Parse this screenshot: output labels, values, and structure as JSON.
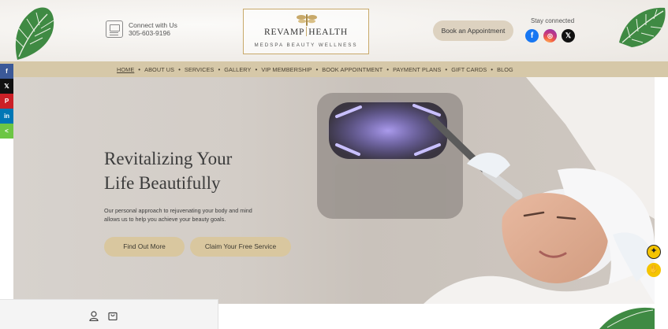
{
  "header": {
    "contact_label": "Connect with Us",
    "phone": "305-603-9196",
    "logo": {
      "name_left": "REVAMP",
      "name_right": "HEALTH",
      "tagline": "MEDSPA BEAUTY WELLNESS"
    },
    "book_button": "Book an Appointment",
    "stay_connected": "Stay connected",
    "social": [
      {
        "name": "facebook-icon",
        "glyph": "f"
      },
      {
        "name": "instagram-icon",
        "glyph": "◎"
      },
      {
        "name": "x-icon",
        "glyph": "𝕏"
      }
    ]
  },
  "nav": {
    "items": [
      "HOME",
      "ABOUT US",
      "SERVICES",
      "GALLERY",
      "VIP MEMBERSHIP",
      "BOOK APPOINTMENT",
      "PAYMENT PLANS",
      "GIFT CARDS",
      "BLOG"
    ],
    "active": "HOME"
  },
  "share_bar": [
    "f",
    "𝕏",
    "P",
    "in",
    "<"
  ],
  "hero": {
    "headline_line1": "Revitalizing Your",
    "headline_line2": "Life Beautifully",
    "body_line1": "Our personal approach to rejuvenating your body and mind",
    "body_line2": "allows us to help you achieve your beauty goals.",
    "button_primary": "Find Out More",
    "button_secondary": "Claim Your Free Service"
  },
  "accessibility": {
    "glyph1": "✦",
    "glyph2": "✋"
  },
  "colors": {
    "nav_bg": "#d6c8a8",
    "button_gold": "#d9c79f",
    "logo_border": "#c8a96a",
    "facebook": "#1877f2",
    "accessibility_yellow": "#f5c400"
  }
}
